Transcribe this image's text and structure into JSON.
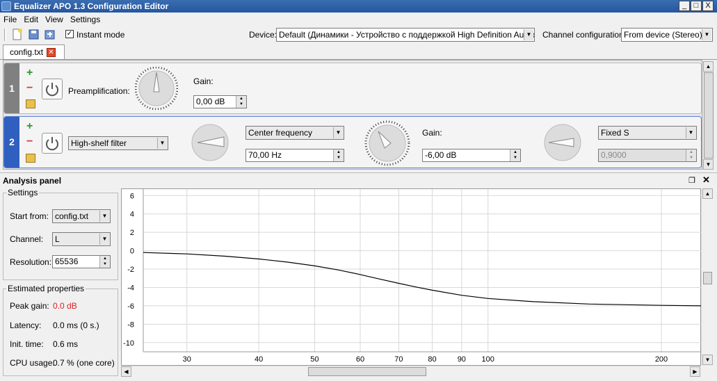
{
  "window": {
    "title": "Equalizer APO 1.3 Configuration Editor",
    "minimize": "_",
    "maximize": "□",
    "close": "X"
  },
  "menu": [
    "File",
    "Edit",
    "View",
    "Settings"
  ],
  "toolbar": {
    "instant_mode_label": "Instant mode",
    "instant_mode_checked": true,
    "device_label": "Device:",
    "device_value": "Default (Динамики - Устройство с поддержкой High Definition Audio)",
    "channel_config_label": "Channel configuration:",
    "channel_config_value": "From device (Stereo)"
  },
  "tab": {
    "label": "config.txt"
  },
  "filters": [
    {
      "number": "1",
      "label": "Preamplification:",
      "gain_label": "Gain:",
      "gain_value": "0,00 dB"
    },
    {
      "number": "2",
      "type": "High-shelf filter",
      "freq_mode": "Center frequency",
      "freq_value": "70,00 Hz",
      "gain_label": "Gain:",
      "gain_value": "-6,00 dB",
      "q_mode": "Fixed S",
      "q_value": "0,9000"
    }
  ],
  "analysis": {
    "title": "Analysis panel",
    "settings_title": "Settings",
    "start_from_label": "Start from:",
    "start_from_value": "config.txt",
    "channel_label": "Channel:",
    "channel_value": "L",
    "resolution_label": "Resolution:",
    "resolution_value": "65536",
    "estimated_title": "Estimated properties",
    "peak_gain_label": "Peak gain:",
    "peak_gain_value": "0.0 dB",
    "latency_label": "Latency:",
    "latency_value": "0.0 ms (0 s.)",
    "init_time_label": "Init. time:",
    "init_time_value": "0.6 ms",
    "cpu_label": "CPU usage:",
    "cpu_value": "0.7 % (one core)"
  },
  "colors": {
    "peak_gain": "#e02020",
    "curve": "#000000",
    "grid": "#d8d8d8",
    "row_selected": "#2f5fbf",
    "row_normal": "#808080"
  },
  "chart_data": {
    "type": "line",
    "xscale": "log",
    "x_ticks": [
      30,
      40,
      50,
      60,
      70,
      80,
      90,
      100,
      200
    ],
    "y_ticks": [
      6,
      4,
      2,
      0,
      -2,
      -4,
      -6,
      -8,
      -10
    ],
    "ylim": [
      -11,
      6.7
    ],
    "xlim": [
      25.2,
      235
    ],
    "series": [
      {
        "x": [
          25.2,
          30,
          35,
          40,
          45,
          50,
          55,
          60,
          65,
          70,
          75,
          80,
          90,
          100,
          120,
          150,
          200,
          235
        ],
        "y": [
          -0.2,
          -0.35,
          -0.6,
          -0.9,
          -1.25,
          -1.65,
          -2.1,
          -2.6,
          -3.1,
          -3.55,
          -3.95,
          -4.3,
          -4.85,
          -5.2,
          -5.55,
          -5.8,
          -5.95,
          -6.0
        ]
      }
    ]
  }
}
